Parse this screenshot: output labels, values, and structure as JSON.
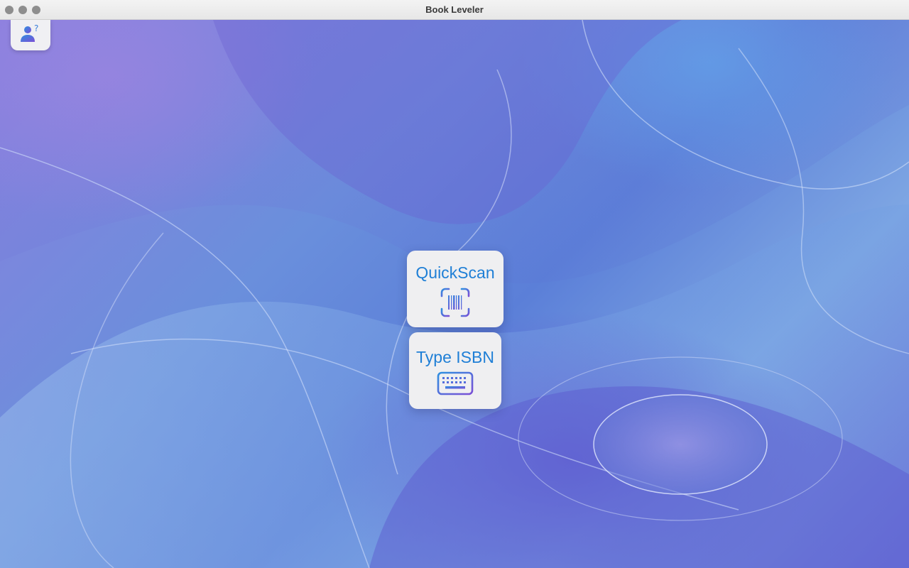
{
  "window": {
    "title": "Book Leveler"
  },
  "help_button": {
    "icon": "person-question-icon"
  },
  "actions": {
    "quickscan": {
      "label": "QuickScan",
      "icon": "barcode-viewfinder-icon"
    },
    "type_isbn": {
      "label": "Type ISBN",
      "icon": "keyboard-icon"
    }
  },
  "colors": {
    "accent": "#1f7fd6",
    "icon_gradient_start": "#2f8fe0",
    "icon_gradient_end": "#7a4fd6"
  }
}
